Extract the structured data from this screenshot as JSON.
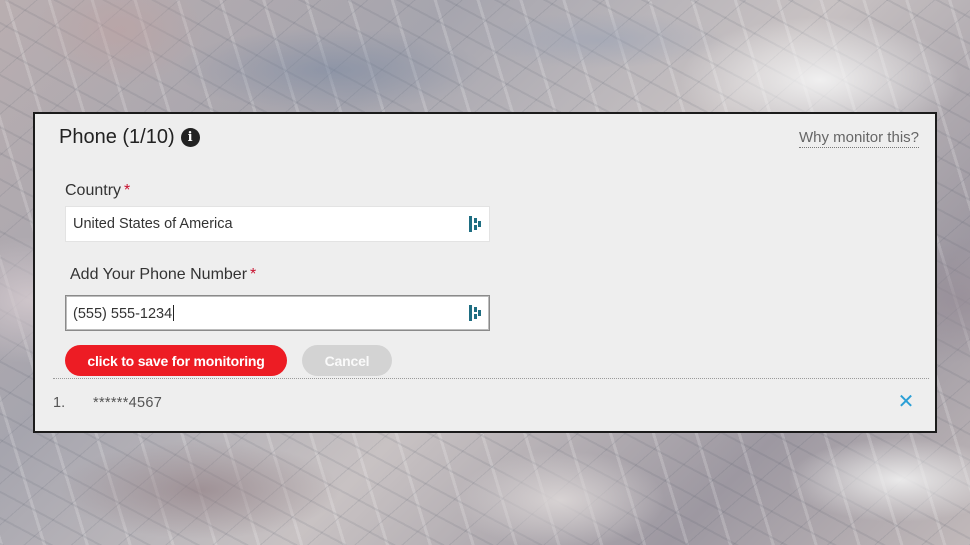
{
  "panel": {
    "title": "Phone (1/10)",
    "info_icon": "info-icon",
    "why_link": "Why monitor this?"
  },
  "country": {
    "label": "Country",
    "required_mark": "*",
    "value": "United States of America",
    "icon": "dashlane-autofill-icon"
  },
  "phone": {
    "label": "Add Your Phone Number",
    "required_mark": "*",
    "value": "(555) 555-1234",
    "icon": "dashlane-autofill-icon"
  },
  "buttons": {
    "save_label": "click to save for monitoring",
    "cancel_label": "Cancel",
    "save_color": "#ed1c24",
    "cancel_color": "#d3d3d3"
  },
  "monitored": [
    {
      "index": "1.",
      "value": "******4567"
    }
  ],
  "colors": {
    "accent_remove": "#2a9fd6",
    "required": "#c8102e"
  }
}
